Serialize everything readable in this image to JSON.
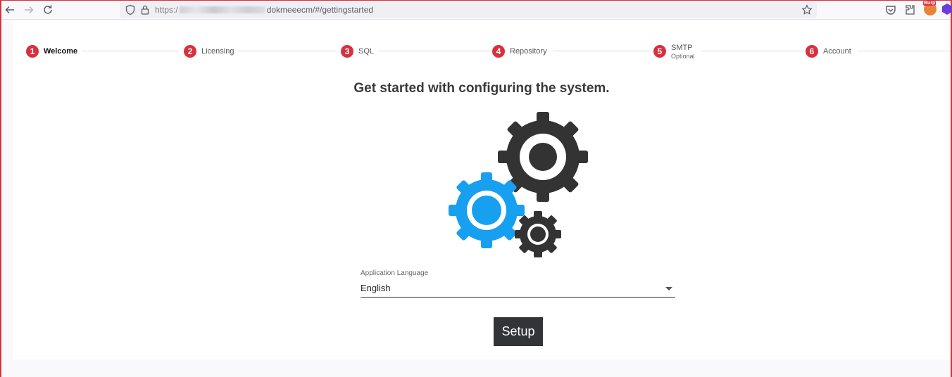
{
  "browser": {
    "url_prefix": "https:/",
    "url_path": "dokmeeecm/#/gettingstarted",
    "extension_badge": "Burp",
    "icons": [
      "back-arrow-icon",
      "forward-arrow-icon",
      "reload-icon",
      "shield-icon",
      "lock-icon",
      "star-icon",
      "pocket-icon",
      "extensions-icon",
      "burp-icon",
      "purple-extension-icon"
    ]
  },
  "stepper": {
    "steps": [
      {
        "number": "1",
        "label": "Welcome",
        "active": true
      },
      {
        "number": "2",
        "label": "Licensing"
      },
      {
        "number": "3",
        "label": "SQL"
      },
      {
        "number": "4",
        "label": "Repository"
      },
      {
        "number": "5",
        "label": "SMTP",
        "sublabel": "Optional"
      },
      {
        "number": "6",
        "label": "Account"
      }
    ]
  },
  "main": {
    "heading": "Get started with configuring the system.",
    "language": {
      "label": "Application Language",
      "value": "English"
    },
    "setup_label": "Setup"
  },
  "colors": {
    "step_badge": "#d9303d",
    "gear_dark": "#333333",
    "gear_blue": "#17a0f0",
    "button": "#333438"
  }
}
